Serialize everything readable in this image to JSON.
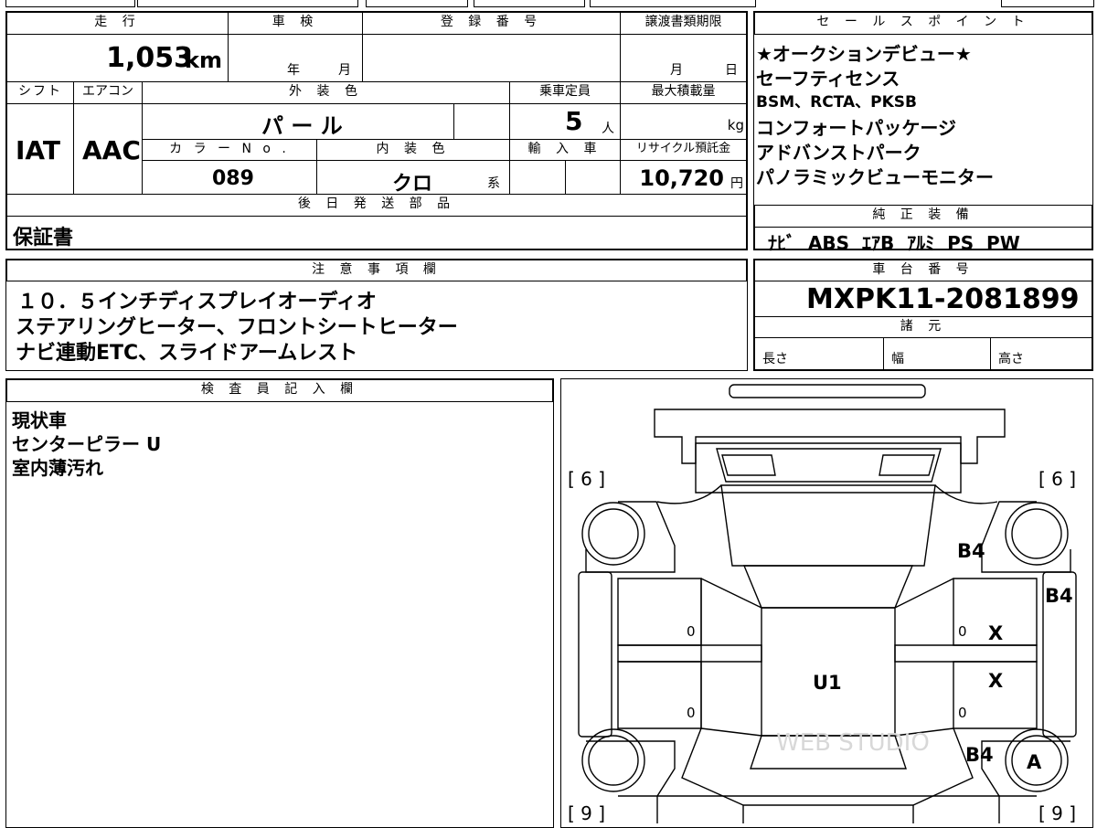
{
  "vehicle_info": {
    "mileage_header": "走 行",
    "mileage_value": "1,053",
    "mileage_unit": "km",
    "inspection_header": "車 検",
    "inspection_year_label": "年",
    "inspection_month_label": "月",
    "registration_header": "登 録 番 号",
    "transfer_header": "譲渡書類期限",
    "transfer_month_label": "月",
    "transfer_day_label": "日",
    "shift_header": "シフト",
    "shift_value": "IAT",
    "ac_header": "エアコン",
    "ac_value": "AAC",
    "exterior_color_header": "外 装 色",
    "exterior_color_value": "パ ー ル",
    "capacity_header": "乗車定員",
    "capacity_value": "5",
    "capacity_unit": "人",
    "max_load_header": "最大積載量",
    "max_load_unit": "kg",
    "color_no_header": "カ ラ ー N o .",
    "color_no_value": "089",
    "interior_color_header": "内 装 色",
    "interior_color_value": "クロ",
    "interior_color_suffix": "系",
    "import_header": "輸 入 車",
    "recycle_header": "リサイクル預託金",
    "recycle_value": "10,720",
    "recycle_unit": "円"
  },
  "later_parts": {
    "header": "後 日 発 送 部 品",
    "value": "保証書"
  },
  "notes": {
    "header": "注 意 事 項 欄",
    "lines": [
      "１０．５インチディスプレイオーディオ",
      "ステアリングヒーター、フロントシートヒーター",
      "ナビ連動ETC、スライドアームレスト"
    ]
  },
  "sales_points": {
    "header": "セ ー ル ス ポ イ ン ト",
    "lines": [
      "★オークションデビュー★",
      "セーフティセンス",
      "BSM、RCTA、PKSB",
      "コンフォートパッケージ",
      "アドバンストパーク",
      "パノラミックビューモニター"
    ]
  },
  "equipment": {
    "header": "純 正 装 備",
    "value": "ﾅﾋﾞ  ABS  ｴｱB  ｱﾙﾐ  PS  PW"
  },
  "chassis": {
    "header": "車 台 番 号",
    "value": "MXPK11-2081899",
    "specs_header": "諸 元",
    "length_label": "長さ",
    "width_label": "幅",
    "height_label": "高さ"
  },
  "inspector": {
    "header": "検 査 員 記 入 欄",
    "lines": [
      "現状車",
      "センターピラー U",
      "室内薄汚れ"
    ]
  },
  "diagram": {
    "tire_front_left": "[ 6 ]",
    "tire_front_right": "[ 6 ]",
    "tire_rear_left": "[ 9 ]",
    "tire_rear_right": "[ 9 ]",
    "mark_front_right_fender": "B4",
    "mark_right_front_door_edge": "B4",
    "mark_front_door_right": "X",
    "mark_rear_door_right": "X",
    "mark_center_pillar": "U1",
    "mark_rear_right_fender": "B4",
    "mark_rear_right_wheel": "A",
    "zero_1": "0",
    "zero_2": "0",
    "zero_3": "0",
    "zero_4": "0"
  },
  "watermark": "WEB STUDIO"
}
